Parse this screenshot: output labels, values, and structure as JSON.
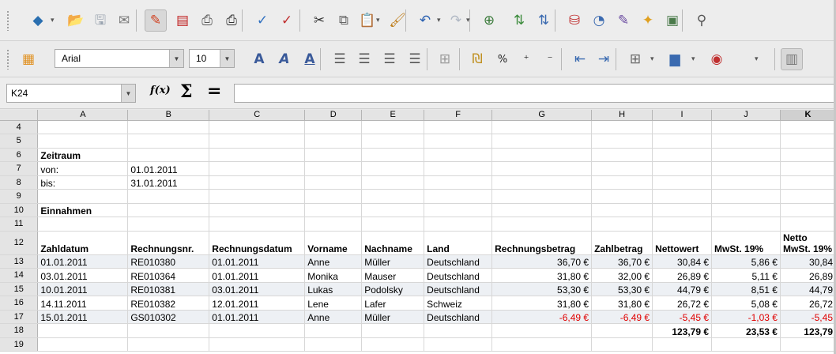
{
  "toolbar1": {
    "buttons": [
      {
        "name": "app-menu-icon",
        "glyph": "◆",
        "color": "#2a6fb0"
      },
      {
        "name": "open-icon",
        "glyph": "📂",
        "color": "#c49a2c"
      },
      {
        "name": "save-icon",
        "glyph": "🖫",
        "color": "#9aa4b0"
      },
      {
        "name": "email-icon",
        "glyph": "✉",
        "color": "#777777"
      },
      {
        "name": "edit-mode-icon",
        "glyph": "✎",
        "color": "#d04020"
      },
      {
        "name": "export-pdf-icon",
        "glyph": "▤",
        "color": "#c02020"
      },
      {
        "name": "print-icon",
        "glyph": "⎙",
        "color": "#555555"
      },
      {
        "name": "print-preview-icon",
        "glyph": "⎙",
        "color": "#333333"
      },
      {
        "name": "spellcheck-icon",
        "glyph": "✓",
        "color": "#3070c0"
      },
      {
        "name": "autospellcheck-icon",
        "glyph": "✓",
        "color": "#c03030"
      },
      {
        "name": "cut-icon",
        "glyph": "✂",
        "color": "#333333"
      },
      {
        "name": "copy-icon",
        "glyph": "⧉",
        "color": "#666666"
      },
      {
        "name": "paste-icon",
        "glyph": "📋",
        "color": "#8a6a3a"
      },
      {
        "name": "clone-format-icon",
        "glyph": "🖌",
        "color": "#c08020"
      },
      {
        "name": "undo-icon",
        "glyph": "↶",
        "color": "#2a60b0"
      },
      {
        "name": "redo-icon",
        "glyph": "↷",
        "color": "#b0b8c4"
      },
      {
        "name": "hyperlink-icon",
        "glyph": "⊕",
        "color": "#3a7a3a"
      },
      {
        "name": "sort-ascending-icon",
        "glyph": "⇅",
        "color": "#3a8a3a"
      },
      {
        "name": "sort-descending-icon",
        "glyph": "⇅",
        "color": "#3a6ab0"
      },
      {
        "name": "autofilter-icon",
        "glyph": "⛁",
        "color": "#c03030"
      },
      {
        "name": "chart-icon",
        "glyph": "◔",
        "color": "#3a6ab0"
      },
      {
        "name": "draw-functions-icon",
        "glyph": "✎",
        "color": "#6a4aa0"
      },
      {
        "name": "navigator-icon",
        "glyph": "✦",
        "color": "#e0a020"
      },
      {
        "name": "gallery-icon",
        "glyph": "▣",
        "color": "#4a7a4a"
      },
      {
        "name": "zoom-icon",
        "glyph": "⚲",
        "color": "#555555"
      }
    ]
  },
  "toolbar2": {
    "font_name": "Arial",
    "font_size": "10",
    "buttons": [
      {
        "name": "styles-icon",
        "glyph": "▦",
        "color": "#e09020"
      },
      {
        "name": "bold-icon",
        "glyph": "A",
        "color": "#3a5a9a"
      },
      {
        "name": "italic-icon",
        "glyph": "A",
        "color": "#3a5a9a"
      },
      {
        "name": "underline-icon",
        "glyph": "A",
        "color": "#3a5a9a"
      },
      {
        "name": "align-left-icon",
        "glyph": "☰",
        "color": "#555555"
      },
      {
        "name": "align-center-icon",
        "glyph": "☰",
        "color": "#555555"
      },
      {
        "name": "align-right-icon",
        "glyph": "☰",
        "color": "#555555"
      },
      {
        "name": "justify-icon",
        "glyph": "☰",
        "color": "#555555"
      },
      {
        "name": "merge-cells-icon",
        "glyph": "⊞",
        "color": "#999999"
      },
      {
        "name": "currency-icon",
        "glyph": "₪",
        "color": "#c09020"
      },
      {
        "name": "percent-icon",
        "glyph": "%",
        "color": "#222222"
      },
      {
        "name": "add-decimal-icon",
        "glyph": "⁺",
        "color": "#222222"
      },
      {
        "name": "remove-decimal-icon",
        "glyph": "⁻",
        "color": "#222222"
      },
      {
        "name": "decrease-indent-icon",
        "glyph": "⇤",
        "color": "#3a6ab0"
      },
      {
        "name": "increase-indent-icon",
        "glyph": "⇥",
        "color": "#3a6ab0"
      },
      {
        "name": "borders-icon",
        "glyph": "⊞",
        "color": "#666666"
      },
      {
        "name": "background-color-icon",
        "glyph": "▆",
        "color": "#3a6ab0"
      },
      {
        "name": "font-color-icon",
        "glyph": "◉",
        "color": "#c03030"
      },
      {
        "name": "toggle-sidebar-icon",
        "glyph": "▥",
        "color": "#777777"
      }
    ]
  },
  "formula_bar": {
    "cell_reference": "K24",
    "fx_label": "f(x)",
    "sum_label": "Σ",
    "equals_label": "=",
    "content": ""
  },
  "sheet": {
    "columns": [
      "A",
      "B",
      "C",
      "D",
      "E",
      "F",
      "G",
      "H",
      "I",
      "J",
      "K"
    ],
    "selected_column": "K",
    "rows": [
      {
        "n": "4",
        "cells": [
          "",
          "",
          "",
          "",
          "",
          "",
          "",
          "",
          "",
          "",
          ""
        ]
      },
      {
        "n": "5",
        "cells": [
          "",
          "",
          "",
          "",
          "",
          "",
          "",
          "",
          "",
          "",
          ""
        ]
      },
      {
        "n": "6",
        "cells": [
          "Zeitraum",
          "",
          "",
          "",
          "",
          "",
          "",
          "",
          "",
          "",
          ""
        ],
        "bold": true
      },
      {
        "n": "7",
        "cells": [
          "von:",
          "01.01.2011",
          "",
          "",
          "",
          "",
          "",
          "",
          "",
          "",
          ""
        ]
      },
      {
        "n": "8",
        "cells": [
          "bis:",
          "31.01.2011",
          "",
          "",
          "",
          "",
          "",
          "",
          "",
          "",
          ""
        ]
      },
      {
        "n": "9",
        "cells": [
          "",
          "",
          "",
          "",
          "",
          "",
          "",
          "",
          "",
          "",
          ""
        ]
      },
      {
        "n": "10",
        "cells": [
          "Einnahmen",
          "",
          "",
          "",
          "",
          "",
          "",
          "",
          "",
          "",
          ""
        ],
        "bold": true
      },
      {
        "n": "11",
        "cells": [
          "",
          "",
          "",
          "",
          "",
          "",
          "",
          "",
          "",
          "",
          ""
        ]
      },
      {
        "n": "12",
        "cells": [
          "Zahldatum",
          "Rechnungsnr.",
          "Rechnungsdatum",
          "Vorname",
          "Nachname",
          "Land",
          "Rechnungsbetrag",
          "Zahlbetrag",
          "Nettowert",
          "MwSt. 19%",
          "Netto MwSt. 19%"
        ],
        "bold": true,
        "tall": true
      },
      {
        "n": "13",
        "cells": [
          "01.01.2011",
          "RE010380",
          "01.01.2011",
          "Anne",
          "Müller",
          "Deutschland",
          "36,70 €",
          "36,70 €",
          "30,84 €",
          "5,86 €",
          "30,84"
        ],
        "band": true
      },
      {
        "n": "14",
        "cells": [
          "03.01.2011",
          "RE010364",
          "01.01.2011",
          "Monika",
          "Mauser",
          "Deutschland",
          "31,80 €",
          "32,00 €",
          "26,89 €",
          "5,11 €",
          "26,89"
        ]
      },
      {
        "n": "15",
        "cells": [
          "10.01.2011",
          "RE010381",
          "03.01.2011",
          "Lukas",
          "Podolsky",
          "Deutschland",
          "53,30 €",
          "53,30 €",
          "44,79 €",
          "8,51 €",
          "44,79"
        ],
        "band": true
      },
      {
        "n": "16",
        "cells": [
          "14.11.2011",
          "RE010382",
          "12.01.2011",
          "Lene",
          "Lafer",
          "Schweiz",
          "31,80 €",
          "31,80 €",
          "26,72 €",
          "5,08 €",
          "26,72"
        ]
      },
      {
        "n": "17",
        "cells": [
          "15.01.2011",
          "GS010302",
          "01.01.2011",
          "Anne",
          "Müller",
          "Deutschland",
          "-6,49 €",
          "-6,49 €",
          "-5,45 €",
          "-1,03 €",
          "-5,45"
        ],
        "band": true,
        "negative": true
      },
      {
        "n": "18",
        "cells": [
          "",
          "",
          "",
          "",
          "",
          "",
          "",
          "",
          "123,79 €",
          "23,53 €",
          "123,79"
        ],
        "bold": true
      },
      {
        "n": "19",
        "cells": [
          "",
          "",
          "",
          "",
          "",
          "",
          "",
          "",
          "",
          "",
          ""
        ]
      }
    ]
  },
  "colors": {
    "negative": "#e00000",
    "band": "#edf0f4",
    "header_bg": "#e4e4e4"
  }
}
